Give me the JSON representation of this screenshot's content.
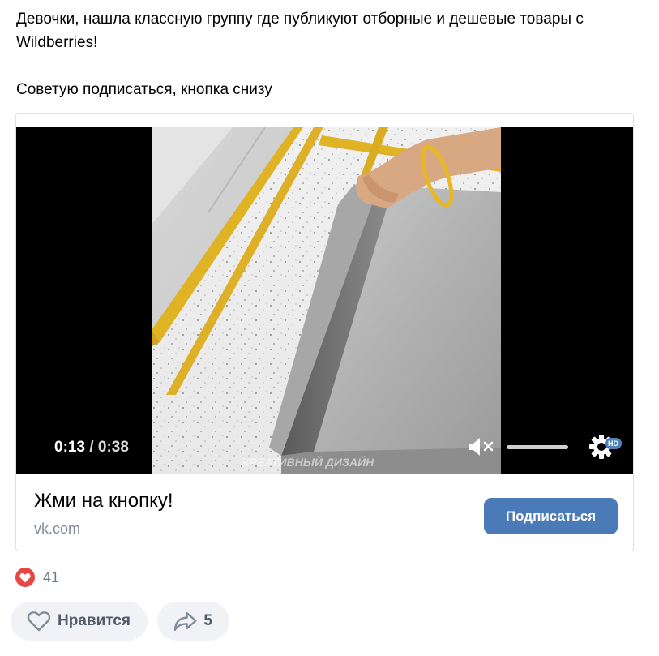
{
  "post": {
    "text_line1": "Девочки, нашла классную группу где публикуют отборные и дешевые товары с Wildberries!",
    "text_line2": "Советую подписаться, кнопка снизу"
  },
  "video": {
    "current_time": "0:13",
    "separator": " / ",
    "duration": "0:38",
    "quality_badge": "HD",
    "watermark": "КРЕАТИВНЫЙ ДИЗАЙН",
    "progress_fraction": 0.342
  },
  "card": {
    "title": "Жми на кнопку!",
    "domain": "vk.com",
    "button_label": "Подписаться",
    "button_color": "#4a7bb8"
  },
  "reactions": {
    "icon": "heart-icon",
    "count": "41",
    "color": "#e64646"
  },
  "actions": {
    "like_label": "Нравится",
    "share_count": "5"
  }
}
